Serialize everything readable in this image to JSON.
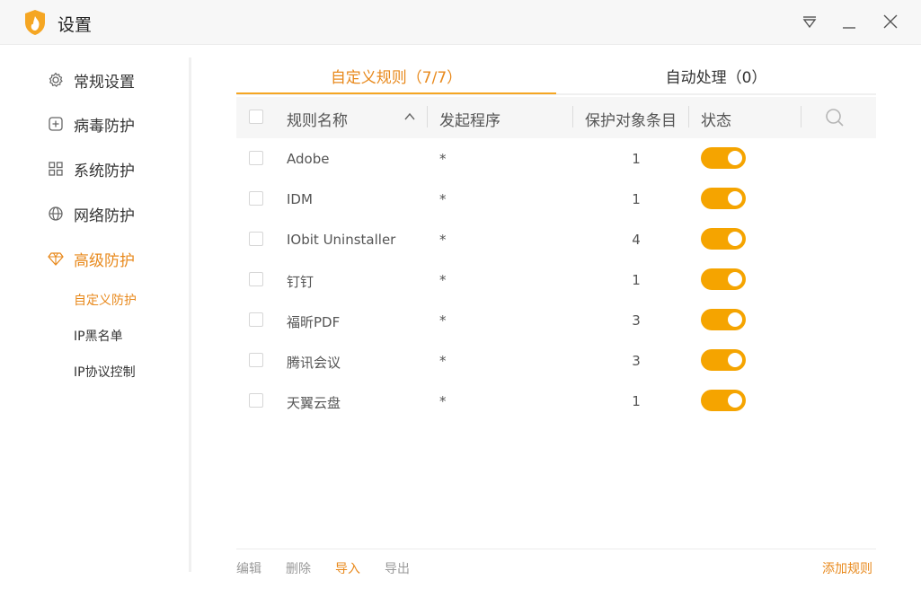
{
  "window": {
    "title": "设置"
  },
  "sidebar": {
    "items": [
      {
        "label": "常规设置",
        "icon": "gear-icon"
      },
      {
        "label": "病毒防护",
        "icon": "plus-square-icon"
      },
      {
        "label": "系统防护",
        "icon": "grid-icon"
      },
      {
        "label": "网络防护",
        "icon": "globe-icon"
      },
      {
        "label": "高级防护",
        "icon": "diamond-icon"
      }
    ],
    "sub_items": [
      {
        "label": "自定义防护"
      },
      {
        "label": "IP黑名单"
      },
      {
        "label": "IP协议控制"
      }
    ]
  },
  "tabs": [
    {
      "label": "自定义规则（7/7）"
    },
    {
      "label": "自动处理（0）"
    }
  ],
  "table": {
    "columns": {
      "name": "规则名称",
      "program": "发起程序",
      "items": "保护对象条目",
      "status": "状态"
    },
    "rows": [
      {
        "name": "Adobe",
        "program": "*",
        "count": "1",
        "enabled": true
      },
      {
        "name": "IDM",
        "program": "*",
        "count": "1",
        "enabled": true
      },
      {
        "name": "IObit Uninstaller",
        "program": "*",
        "count": "4",
        "enabled": true
      },
      {
        "name": "钉钉",
        "program": "*",
        "count": "1",
        "enabled": true
      },
      {
        "name": "福昕PDF",
        "program": "*",
        "count": "3",
        "enabled": true
      },
      {
        "name": "腾讯会议",
        "program": "*",
        "count": "3",
        "enabled": true
      },
      {
        "name": "天翼云盘",
        "program": "*",
        "count": "1",
        "enabled": true
      }
    ]
  },
  "footer": {
    "edit": "编辑",
    "delete": "删除",
    "import": "导入",
    "export": "导出",
    "add_rule": "添加规则"
  },
  "colors": {
    "accent": "#e8891c",
    "toggle_on": "#f5a400"
  }
}
